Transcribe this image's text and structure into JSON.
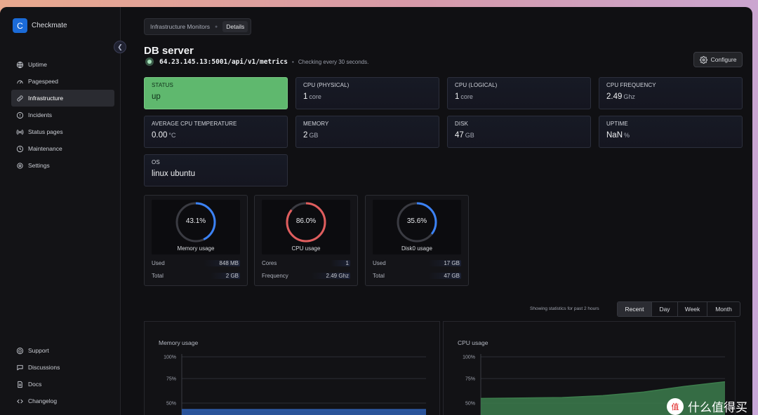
{
  "app": {
    "logo_letter": "C",
    "name": "Checkmate"
  },
  "sidebar": {
    "items": [
      {
        "label": "Uptime",
        "icon": "globe-icon",
        "active": false
      },
      {
        "label": "Pagespeed",
        "icon": "speedometer-icon",
        "active": false
      },
      {
        "label": "Infrastructure",
        "icon": "link-icon",
        "active": true
      },
      {
        "label": "Incidents",
        "icon": "alert-circle-icon",
        "active": false
      },
      {
        "label": "Status pages",
        "icon": "broadcast-icon",
        "active": false
      },
      {
        "label": "Maintenance",
        "icon": "clock-icon",
        "active": false
      },
      {
        "label": "Settings",
        "icon": "gear-icon",
        "active": false
      }
    ],
    "bottom_items": [
      {
        "label": "Support",
        "icon": "support-icon"
      },
      {
        "label": "Discussions",
        "icon": "chat-icon"
      },
      {
        "label": "Docs",
        "icon": "docs-icon"
      },
      {
        "label": "Changelog",
        "icon": "code-icon"
      }
    ]
  },
  "breadcrumb": {
    "parent": "Infrastructure Monitors",
    "current": "Details"
  },
  "header": {
    "title": "DB server",
    "url": "64.23.145.13:5001/api/v1/metrics",
    "check_text": "Checking every 30 seconds.",
    "configure_label": "Configure"
  },
  "stats": [
    {
      "label": "STATUS",
      "value": "up",
      "unit": ""
    },
    {
      "label": "CPU (PHYSICAL)",
      "value": "1",
      "unit": "core"
    },
    {
      "label": "CPU (LOGICAL)",
      "value": "1",
      "unit": "core"
    },
    {
      "label": "CPU FREQUENCY",
      "value": "2.49",
      "unit": "Ghz"
    },
    {
      "label": "AVERAGE CPU TEMPERATURE",
      "value": "0.00",
      "unit": "°C"
    },
    {
      "label": "MEMORY",
      "value": "2",
      "unit": "GB"
    },
    {
      "label": "DISK",
      "value": "47",
      "unit": "GB"
    },
    {
      "label": "UPTIME",
      "value": "NaN",
      "unit": "%"
    },
    {
      "label": "OS",
      "value": "linux ubuntu",
      "unit": ""
    }
  ],
  "gauges": [
    {
      "title": "Memory usage",
      "percent_label": "43.1%",
      "percent": 43.1,
      "color": "#3b82f6",
      "rows": [
        {
          "key": "Used",
          "value": "848 MB"
        },
        {
          "key": "Total",
          "value": "2 GB"
        }
      ]
    },
    {
      "title": "CPU usage",
      "percent_label": "86.0%",
      "percent": 86.0,
      "color": "#e05d5d",
      "rows": [
        {
          "key": "Cores",
          "value": "1"
        },
        {
          "key": "Frequency",
          "value": "2.49 Ghz"
        }
      ]
    },
    {
      "title": "Disk0 usage",
      "percent_label": "35.6%",
      "percent": 35.6,
      "color": "#3b82f6",
      "rows": [
        {
          "key": "Used",
          "value": "17 GB"
        },
        {
          "key": "Total",
          "value": "47 GB"
        }
      ]
    }
  ],
  "range": {
    "note": "Showing statistics for past 2 hours",
    "tabs": [
      {
        "label": "Recent",
        "active": true
      },
      {
        "label": "Day",
        "active": false
      },
      {
        "label": "Week",
        "active": false
      },
      {
        "label": "Month",
        "active": false
      }
    ]
  },
  "charts": [
    {
      "title": "Memory usage",
      "y_ticks": [
        "100%",
        "75%",
        "50%"
      ],
      "color": "#2f5fb0",
      "values": [
        43,
        43,
        43,
        43,
        43,
        43
      ]
    },
    {
      "title": "CPU usage",
      "y_ticks": [
        "100%",
        "75%",
        "50%"
      ],
      "color": "#3c7d4c",
      "values": [
        55,
        55.5,
        56,
        58,
        62,
        68,
        73
      ]
    }
  ],
  "watermark": {
    "text": "什么值得买"
  }
}
